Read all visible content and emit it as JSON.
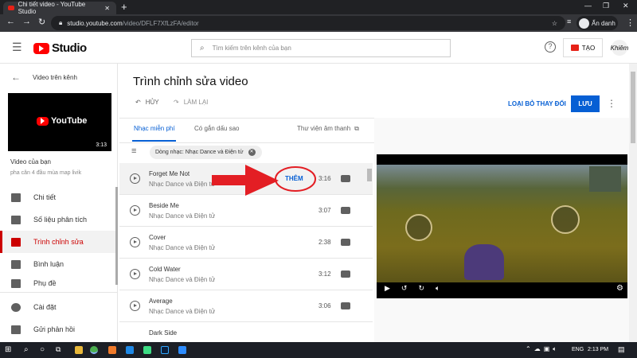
{
  "browser": {
    "tab_title": "Chi tiết video - YouTube Studio",
    "url_host": "studio.youtube.com",
    "url_path": "/video/DFLF7XfLzFA/editor",
    "profile": "Ẩn danh"
  },
  "header": {
    "logo": "Studio",
    "search_placeholder": "Tìm kiếm trên kênh của bạn",
    "create_label": "TẠO",
    "avatar_text": "Khiêm"
  },
  "sidebar": {
    "back_label": "Video trên kênh",
    "thumb_logo": "YouTube",
    "thumb_duration": "3:13",
    "video_heading": "Video của bạn",
    "video_title": "pha cân 4 đầu mùa map livik",
    "items": [
      {
        "label": "Chi tiết",
        "icon": "pencil-icon"
      },
      {
        "label": "Số liệu phân tích",
        "icon": "analytics-icon"
      },
      {
        "label": "Trình chỉnh sửa",
        "icon": "editor-icon",
        "active": true
      },
      {
        "label": "Bình luận",
        "icon": "comments-icon"
      },
      {
        "label": "Phụ đề",
        "icon": "subtitles-icon"
      }
    ],
    "footer": [
      {
        "label": "Cài đặt",
        "icon": "gear-icon"
      },
      {
        "label": "Gửi phản hồi",
        "icon": "feedback-icon"
      }
    ]
  },
  "editor": {
    "title": "Trình chỉnh sửa video",
    "undo": "HỦY",
    "redo": "LÀM LẠI",
    "discard": "LOẠI BỎ THAY ĐỔI",
    "save": "LƯU"
  },
  "audio": {
    "tabs": [
      "Nhạc miễn phí",
      "Có gắn dấu sao"
    ],
    "library_link": "Thư viện âm thanh",
    "filter_chip": "Dòng nhạc: Nhạc Dance và Điện tử",
    "add_label": "THÊM",
    "tracks": [
      {
        "title": "Forget Me Not",
        "genre": "Nhạc Dance và Điện tử",
        "duration": "3:16"
      },
      {
        "title": "Beside Me",
        "genre": "Nhạc Dance và Điện tử",
        "duration": "3:07"
      },
      {
        "title": "Cover",
        "genre": "Nhạc Dance và Điện tử",
        "duration": "2:38"
      },
      {
        "title": "Cold Water",
        "genre": "Nhạc Dance và Điện tử",
        "duration": "3:12"
      },
      {
        "title": "Average",
        "genre": "Nhạc Dance và Điện tử",
        "duration": "3:06"
      },
      {
        "title": "Dark Side",
        "genre": "",
        "duration": ""
      }
    ]
  },
  "taskbar": {
    "lang": "ENG",
    "time": "2:13 PM"
  },
  "colors": {
    "accent": "#065fd4",
    "youtube_red": "#ff0000",
    "annotation_red": "#e31e24"
  }
}
